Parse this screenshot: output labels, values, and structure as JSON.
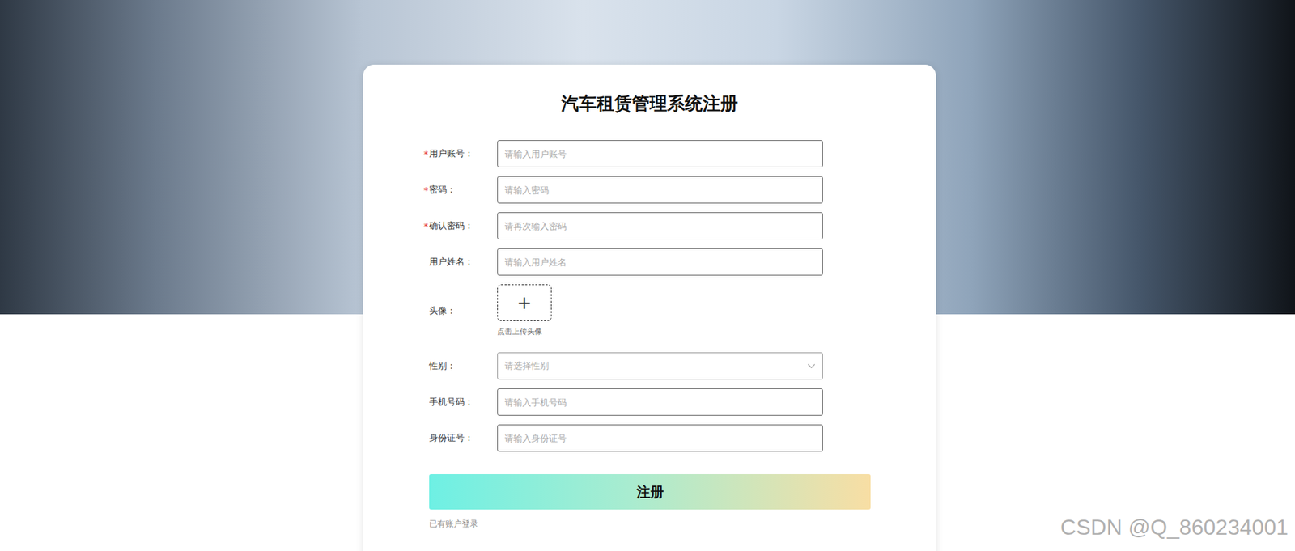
{
  "form": {
    "title": "汽车租赁管理系统注册",
    "fields": [
      {
        "kind": "input",
        "label": "用户账号：",
        "required": true,
        "placeholder": "请输入用户账号"
      },
      {
        "kind": "input",
        "label": "密码：",
        "required": true,
        "placeholder": "请输入密码"
      },
      {
        "kind": "input",
        "label": "确认密码：",
        "required": true,
        "placeholder": "请再次输入密码"
      },
      {
        "kind": "input",
        "label": "用户姓名：",
        "required": false,
        "placeholder": "请输入用户姓名"
      },
      {
        "kind": "upload",
        "label": "头像：",
        "required": false,
        "icon": "+",
        "hint": "点击上传头像"
      },
      {
        "kind": "select",
        "label": "性别：",
        "required": false,
        "placeholder": "请选择性别"
      },
      {
        "kind": "input",
        "label": "手机号码：",
        "required": false,
        "placeholder": "请输入手机号码"
      },
      {
        "kind": "input",
        "label": "身份证号：",
        "required": false,
        "placeholder": "请输入身份证号"
      }
    ],
    "required_mark": "*",
    "submit_button": "注册",
    "login_link": "已有账户登录"
  },
  "watermark": "CSDN @Q_860234001"
}
